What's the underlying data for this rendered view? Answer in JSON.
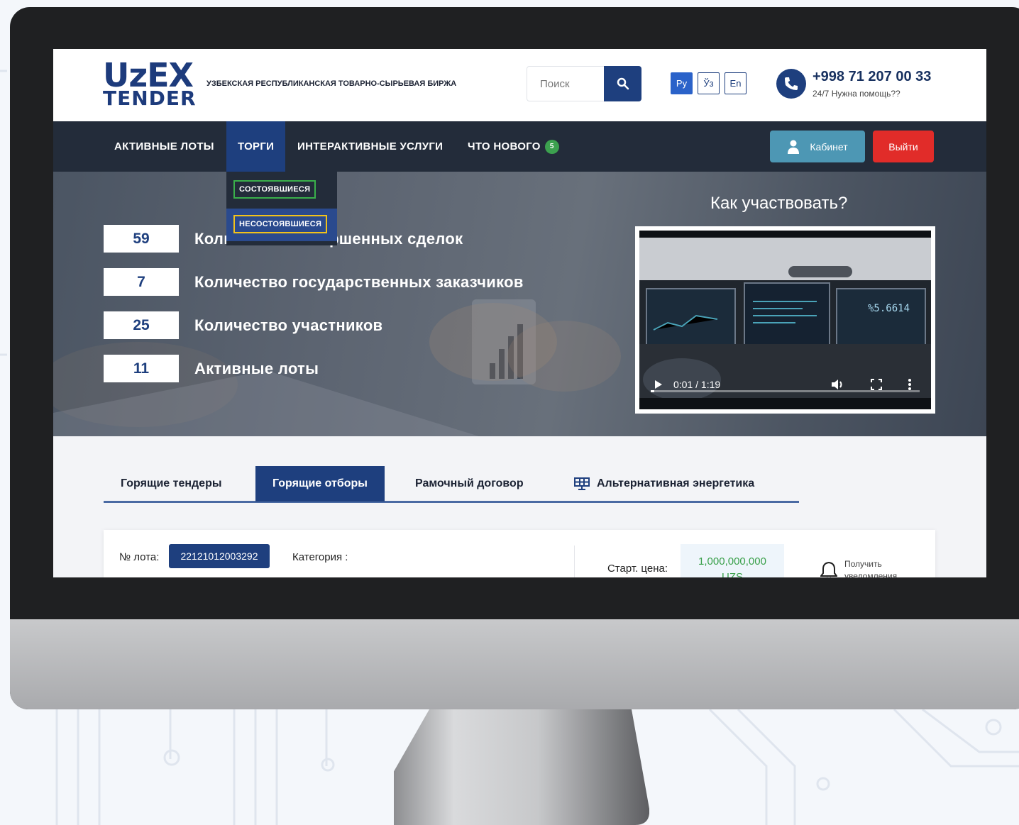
{
  "brand": {
    "logo_top": "UzEX",
    "logo_bottom": "TENDER",
    "exchange_name": "УЗБЕКСКАЯ РЕСПУБЛИКАНСКАЯ ТОВАРНО-СЫРЬЕВАЯ БИРЖА"
  },
  "search": {
    "placeholder": "Поиск"
  },
  "languages": [
    "Ру",
    "Ўз",
    "En"
  ],
  "contact": {
    "phone": "+998 71 207 00 33",
    "support": "24/7 Нужна помощь??"
  },
  "nav": {
    "items": [
      "АКТИВНЫЕ ЛОТЫ",
      "ТОРГИ",
      "ИНТЕРАКТИВНЫЕ УСЛУГИ",
      "ЧТО НОВОГО"
    ],
    "news_badge": "5",
    "cabinet": "Кабинет",
    "logout": "Выйти"
  },
  "dropdown": {
    "items": [
      "СОСТОЯВШИЕСЯ",
      "НЕСОСТОЯВШИЕСЯ"
    ]
  },
  "stats": [
    {
      "value": "59",
      "label": "Количество совершенных сделок"
    },
    {
      "value": "7",
      "label": "Количество государственных заказчиков"
    },
    {
      "value": "25",
      "label": "Количество участников"
    },
    {
      "value": "11",
      "label": "Активные лоты"
    }
  ],
  "video": {
    "title": "Как участвовать?",
    "time": "0:01 / 1:19",
    "progress": 0.013
  },
  "tabs": [
    "Горящие тендеры",
    "Горящие отборы",
    "Рамочный договор",
    "Альтернативная энергетика"
  ],
  "lot": {
    "lot_label": "№ лота:",
    "lot_number": "22121012003292",
    "category_label": "Категория :",
    "price_label": "Старт. цена:",
    "price_value": "1,000,000,000",
    "price_currency": "UZS",
    "notify_label": "Получить уведомления"
  },
  "colors": {
    "brand_blue": "#1e3f7e",
    "nav_dark": "#232c3a",
    "danger": "#e12c29",
    "cabinet": "#4d97b4",
    "success": "#3aa04a"
  }
}
